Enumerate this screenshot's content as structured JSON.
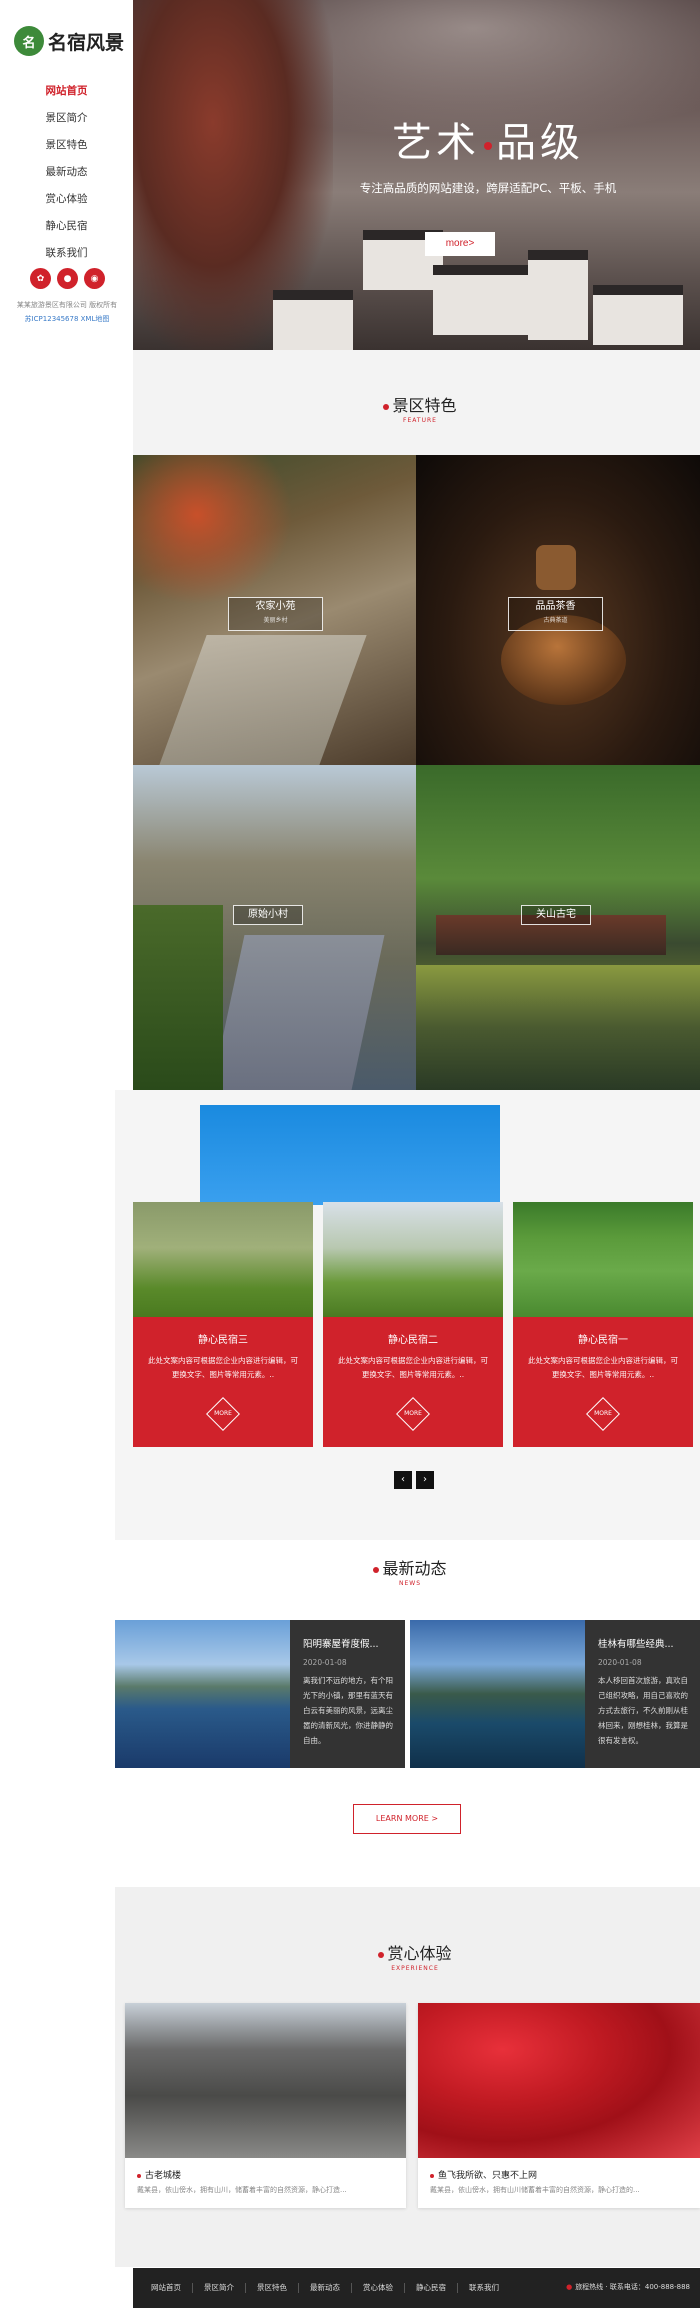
{
  "brand": {
    "logo_mark": "名",
    "name": "名宿风景"
  },
  "nav": [
    "网站首页",
    "景区简介",
    "景区特色",
    "最新动态",
    "赏心体验",
    "静心民宿",
    "联系我们"
  ],
  "socials": [
    {
      "icon": "weibo-icon",
      "glyph": "✿"
    },
    {
      "icon": "wechat-icon",
      "glyph": "●"
    },
    {
      "icon": "qq-icon",
      "glyph": "◉"
    }
  ],
  "copyright": "某某旅游景区有限公司 版权所有",
  "icp": "苏ICP12345678 XML地图",
  "hero": {
    "title_left": "艺术",
    "title_right": "品级",
    "subtitle": "专注高品质的网站建设，跨屏适配PC、平板、手机",
    "button": "more>"
  },
  "feature": {
    "title": "景区特色",
    "title_en": "FEATURE",
    "items": [
      {
        "label": "农家小苑",
        "sub": "美丽乡村"
      },
      {
        "label": "品品茶香",
        "sub": "古典茶道"
      },
      {
        "label": "原始小村",
        "sub": ""
      },
      {
        "label": "关山古宅",
        "sub": ""
      }
    ]
  },
  "cards": [
    {
      "title": "静心民宿三",
      "text": "此处文案内容可根据您企业内容进行编辑，可更换文字、图片等常用元素。..",
      "more": "MORE"
    },
    {
      "title": "静心民宿二",
      "text": "此处文案内容可根据您企业内容进行编辑，可更换文字、图片等常用元素。..",
      "more": "MORE"
    },
    {
      "title": "静心民宿一",
      "text": "此处文案内容可根据您企业内容进行编辑，可更换文字、图片等常用元素。..",
      "more": "MORE"
    }
  ],
  "pager": {
    "prev": "‹",
    "next": "›"
  },
  "news": {
    "title": "最新动态",
    "title_en": "NEWS",
    "items": [
      {
        "title": "阳明寨屋脊度假...",
        "date": "2020-01-08",
        "text": "离我们不远的地方，有个阳光下的小镇，那里有蓝天有白云有美丽的风景，远离尘嚣的清新风光，你进静静的自由。"
      },
      {
        "title": "桂林有哪些经典...",
        "date": "2020-01-08",
        "text": "本人移回首次旅游，真欢自己组织攻略，用自己喜欢的方式去旅行，不久前刚从桂林回来，刚想桂林，我算是很有发言权。"
      }
    ],
    "learn_more": "LEARN MORE >"
  },
  "experience": {
    "title": "赏心体验",
    "title_en": "EXPERIENCE",
    "items": [
      {
        "title": "古老城楼",
        "text": "戴某县，依山傍水，拥有山川，储蓄着丰富的自然资源，静心打造..."
      },
      {
        "title": "鱼飞我所欲、只惠不上网",
        "text": "戴某县，依山傍水，拥有山川储蓄着丰富的自然资源，静心打造的..."
      }
    ]
  },
  "footer": {
    "links": [
      "网站首页",
      "景区简介",
      "景区特色",
      "最新动态",
      "赏心体验",
      "静心民宿",
      "联系我们"
    ],
    "hotline": "旅程热线 · 联系电话：400-888-888"
  },
  "colors": {
    "accent": "#d0222b",
    "dark": "#222222"
  }
}
